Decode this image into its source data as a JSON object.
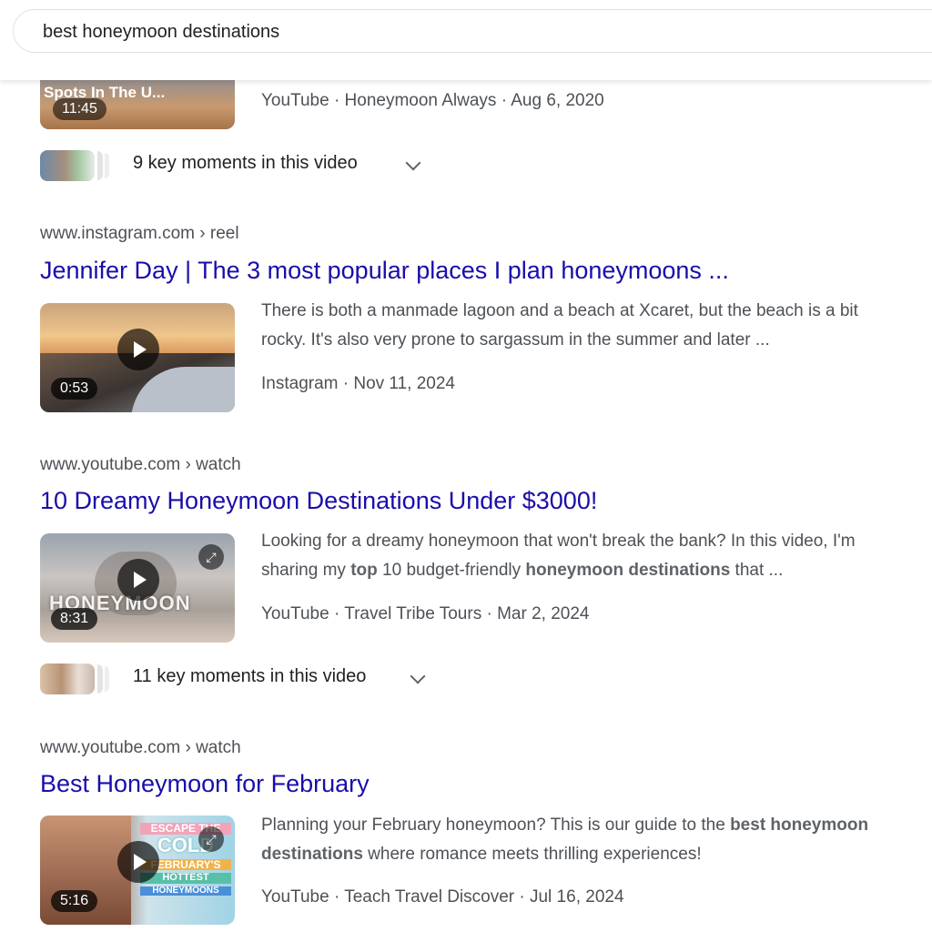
{
  "search": {
    "query": "best honeymoon destinations"
  },
  "results": [
    {
      "duration": "11:45",
      "thumb_text": "Spots In The U...",
      "meta": "YouTube · Honeymoon Always · Aug 6, 2020",
      "key_moments": "9 key moments in this video"
    },
    {
      "source": "www.instagram.com › reel",
      "title": "Jennifer Day | The 3 most popular places I plan honeymoons ...",
      "snippet_line1": "There is both a manmade lagoon and a beach at Xcaret, but the beach is a bit",
      "snippet_line2": "rocky. It's also very prone to sargassum in the summer and later ...",
      "duration": "0:53",
      "meta": "Instagram · Nov 11, 2024"
    },
    {
      "source": "www.youtube.com › watch",
      "title": "10 Dreamy Honeymoon Destinations Under $3000!",
      "snippet_line1": "Looking for a dreamy honeymoon that won't break the bank? In this video, I'm",
      "snippet_pre": "sharing my ",
      "snippet_b1": "top",
      "snippet_mid": " 10 budget-friendly ",
      "snippet_b2": "honeymoon destinations",
      "snippet_post": " that ...",
      "duration": "8:31",
      "thumb_text": "HONEYMOON",
      "meta": "YouTube · Travel Tribe Tours · Mar 2, 2024",
      "key_moments": "11 key moments in this video"
    },
    {
      "source": "www.youtube.com › watch",
      "title": "Best Honeymoon for February",
      "snippet_pre": "Planning your February honeymoon? This is our guide to the ",
      "snippet_b1": "best honeymoon",
      "snippet_b2": "destinations",
      "snippet_post": " where romance meets thrilling experiences!",
      "duration": "5:16",
      "thumb_text1": "ESCAPE THE",
      "thumb_text2": "COLD",
      "thumb_text3": "FEBRUARY'S",
      "thumb_text4": "HOTTEST",
      "thumb_text5": "HONEYMOONS",
      "meta": "YouTube · Teach Travel Discover · Jul 16, 2024"
    }
  ],
  "colors": {
    "link": "#1a0dab",
    "text": "#4d5156",
    "dark": "#202124"
  }
}
